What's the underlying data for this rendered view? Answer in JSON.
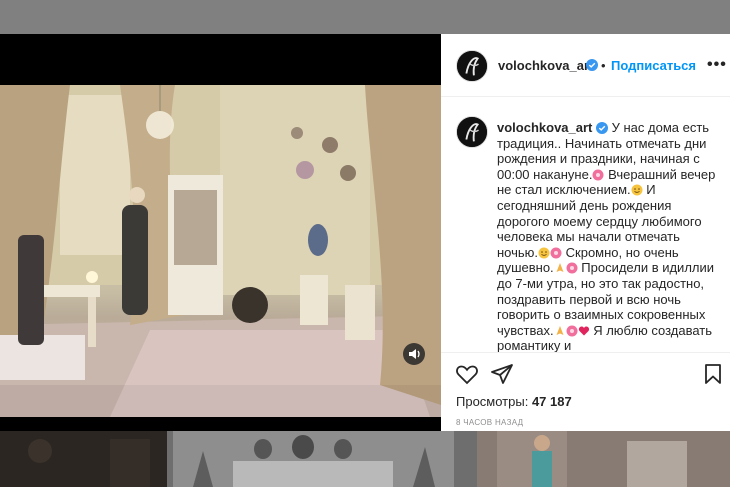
{
  "post": {
    "username": "volochkova_art",
    "follow_label": "Подписаться",
    "separator": "•",
    "more_label": "•••",
    "caption_username": "volochkova_art",
    "caption_parts": [
      "У нас дома есть традиция.. Начинать отмечать дни рождения и праздники, начиная с 00:00 накануне.",
      " Вчерашний вечер не стал исключением.",
      " И сегодняшний день рождения дорогого моему сердцу любимого человека мы начали отмечать ночью.",
      " Скромно, но очень душевно.",
      " Просидели в идиллии до 7-ми утра, но это так радостно, поздравить первой и всю ночь говорить о взаимных сокровенных чувствах.",
      " Я люблю создавать романтику и"
    ],
    "views_label": "Просмотры:",
    "views_count": "47 187",
    "time_ago": "8 ЧАСОВ НАЗАД"
  },
  "icons": {
    "verified": "verified-badge-icon",
    "like": "heart-outline-icon",
    "share": "paper-plane-icon",
    "save": "bookmark-icon",
    "sound": "speaker-icon"
  },
  "colors": {
    "accent": "#0095f6",
    "text": "#262626",
    "muted": "#8e8e8e",
    "verified": "#3897f0",
    "heart": "#e0245e"
  }
}
